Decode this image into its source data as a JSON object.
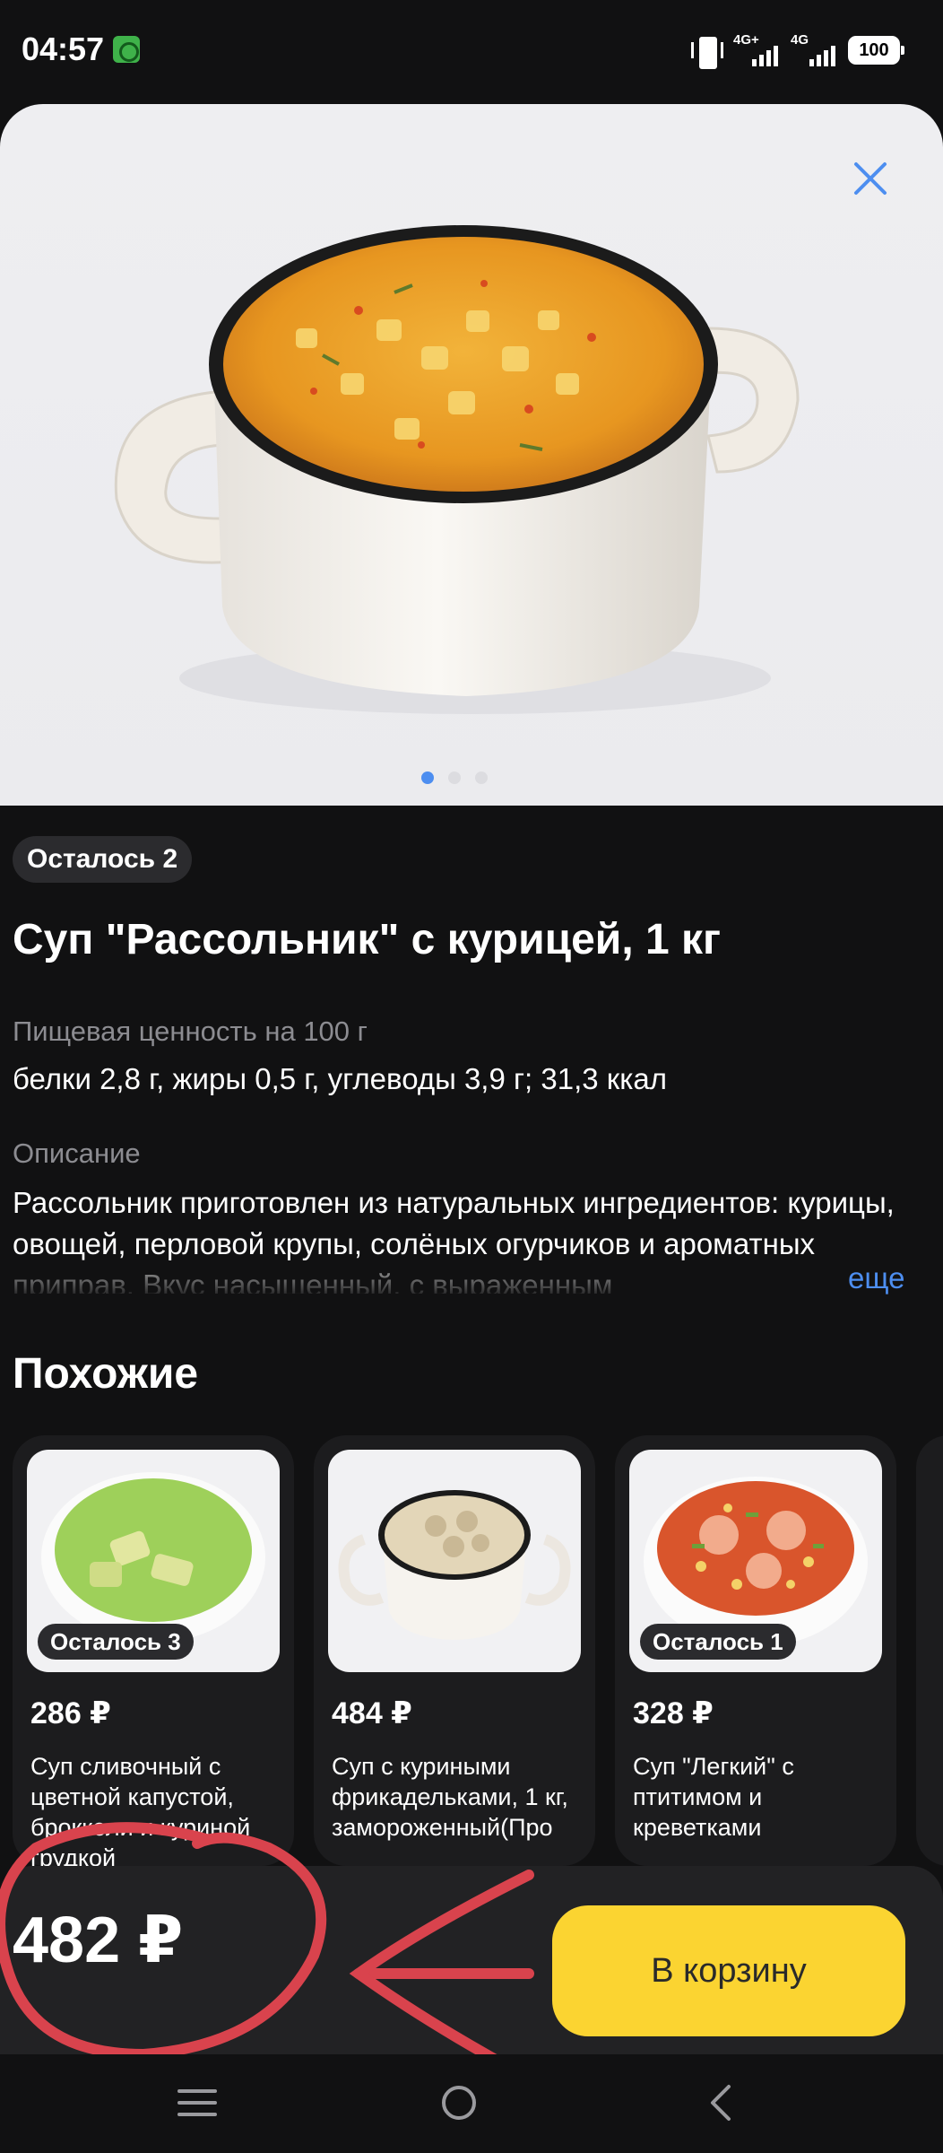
{
  "status_bar": {
    "time": "04:57",
    "network_1": "4G+",
    "network_2": "4G",
    "battery": "100"
  },
  "product": {
    "stock_badge": "Осталось 2",
    "title": "Суп \"Рассольник\" с курицей, 1 кг",
    "nutrition_label": "Пищевая ценность на 100 г",
    "nutrition_value": "белки 2,8 г, жиры 0,5 г, углеводы 3,9 г; 31,3 ккал",
    "description_label": "Описание",
    "description_text": "Рассольник приготовлен из натуральных ингредиентов: курицы, овощей, перловой крупы, солёных огурчиков и ароматных приправ. Вкус насыщенный, с выраженным",
    "more_link": "еще",
    "image_dots": 3,
    "active_dot": 1
  },
  "similar": {
    "title": "Похожие",
    "items": [
      {
        "badge": "Осталось 3",
        "price": "286 ₽",
        "name": "Суп сливочный с цветной капустой, брокколи и куриной грудкой"
      },
      {
        "badge": "",
        "price": "484 ₽",
        "name": "Суп с куриными фрикадельками, 1 кг, замороженный(Про"
      },
      {
        "badge": "Осталось 1",
        "price": "328 ₽",
        "name": "Суп \"Легкий\" с птитимом и креветками"
      }
    ]
  },
  "bottom_bar": {
    "price": "482 ₽",
    "cart_button": "В корзину"
  },
  "colors": {
    "background": "#111112",
    "accent_yellow": "#fbd431",
    "link_blue": "#4d8ef0",
    "annotation_red": "#d9434d"
  },
  "icons": {
    "close": "close-icon",
    "nav_menu": "menu-icon",
    "nav_home": "home-icon",
    "nav_back": "back-icon"
  }
}
